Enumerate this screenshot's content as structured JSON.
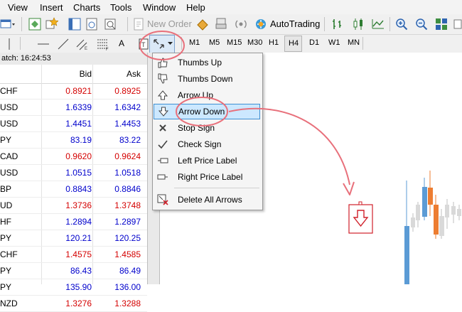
{
  "menubar": {
    "items": [
      {
        "label": "View"
      },
      {
        "label": "Insert"
      },
      {
        "label": "Charts"
      },
      {
        "label": "Tools"
      },
      {
        "label": "Window"
      },
      {
        "label": "Help"
      }
    ]
  },
  "toolbar": {
    "new_order_label": "New Order",
    "autotrading_label": "AutoTrading",
    "text_tool_label": "A",
    "timeframes": [
      "M1",
      "M5",
      "M15",
      "M30",
      "H1",
      "H4",
      "D1",
      "W1",
      "MN"
    ],
    "active_timeframe": "H4"
  },
  "market_watch": {
    "title": "atch: 16:24:53",
    "columns": {
      "bid": "Bid",
      "ask": "Ask"
    },
    "rows": [
      {
        "symbol": "CHF",
        "bid": "0.8921",
        "ask": "0.8925",
        "color": "#d40000"
      },
      {
        "symbol": "USD",
        "bid": "1.6339",
        "ask": "1.6342",
        "color": "#0000cc"
      },
      {
        "symbol": "USD",
        "bid": "1.4451",
        "ask": "1.4453",
        "color": "#0000cc"
      },
      {
        "symbol": "PY",
        "bid": "83.19",
        "ask": "83.22",
        "color": "#0000cc"
      },
      {
        "symbol": "CAD",
        "bid": "0.9620",
        "ask": "0.9624",
        "color": "#d40000"
      },
      {
        "symbol": "USD",
        "bid": "1.0515",
        "ask": "1.0518",
        "color": "#0000cc"
      },
      {
        "symbol": "BP",
        "bid": "0.8843",
        "ask": "0.8846",
        "color": "#0000cc"
      },
      {
        "symbol": "UD",
        "bid": "1.3736",
        "ask": "1.3748",
        "color": "#d40000"
      },
      {
        "symbol": "HF",
        "bid": "1.2894",
        "ask": "1.2897",
        "color": "#0000cc"
      },
      {
        "symbol": "PY",
        "bid": "120.21",
        "ask": "120.25",
        "color": "#0000cc"
      },
      {
        "symbol": "CHF",
        "bid": "1.4575",
        "ask": "1.4585",
        "color": "#d40000"
      },
      {
        "symbol": "PY",
        "bid": "86.43",
        "ask": "86.49",
        "color": "#0000cc"
      },
      {
        "symbol": "PY",
        "bid": "135.90",
        "ask": "136.00",
        "color": "#0000cc"
      },
      {
        "symbol": "NZD",
        "bid": "1.3276",
        "ask": "1.3288",
        "color": "#d40000"
      }
    ]
  },
  "dropdown": {
    "items": [
      {
        "label": "Thumbs Up",
        "icon": "thumbs-up-icon"
      },
      {
        "label": "Thumbs Down",
        "icon": "thumbs-down-icon"
      },
      {
        "label": "Arrow Up",
        "icon": "arrow-up-icon"
      },
      {
        "label": "Arrow Down",
        "icon": "arrow-down-icon",
        "selected": true
      },
      {
        "label": "Stop Sign",
        "icon": "stop-sign-icon"
      },
      {
        "label": "Check Sign",
        "icon": "check-sign-icon"
      },
      {
        "label": "Left Price Label",
        "icon": "left-price-label-icon"
      },
      {
        "label": "Right Price Label",
        "icon": "right-price-label-icon"
      },
      {
        "label": "Delete All Arrows",
        "icon": "delete-arrows-icon"
      }
    ]
  },
  "colors": {
    "annotation": "#e8707b",
    "bid_down": "#d40000",
    "bid_up": "#0000cc",
    "candle_bull": "#5b9bd5",
    "candle_bear": "#ed7d31",
    "candle_neutral": "#bfbfbf",
    "selection": "#cce8ff"
  }
}
